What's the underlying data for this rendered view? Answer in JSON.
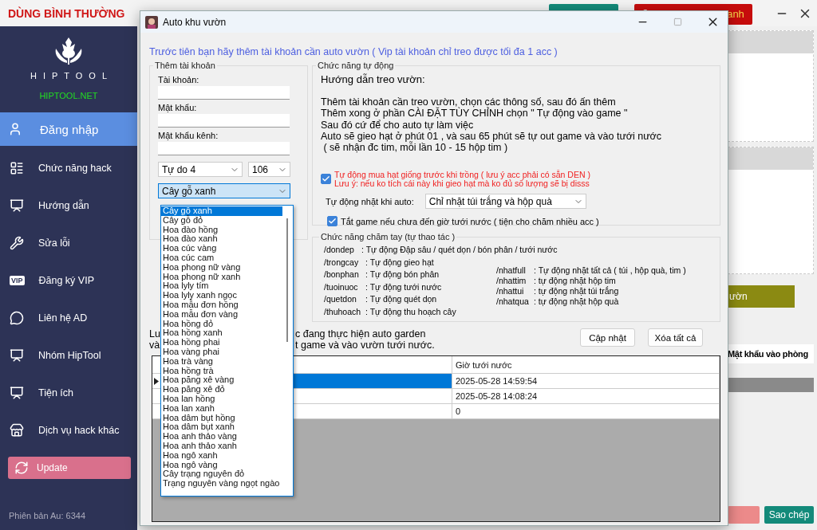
{
  "app": {
    "title": "DÙNG BÌNH THƯỜNG",
    "top_buttons": [
      {
        "kind": "teal"
      },
      {
        "kind": "danger",
        "label": "anh"
      }
    ]
  },
  "sidebar": {
    "brand": "HIPTOOL",
    "site": "HIPTOOL.NET",
    "items": [
      {
        "label": "Đăng nhập",
        "selected": true
      },
      {
        "label": "Chức năng hack",
        "selected": false
      },
      {
        "label": "Hướng dẫn",
        "selected": false
      },
      {
        "label": "Sửa lỗi",
        "selected": false
      },
      {
        "label": "Đăng ký  VIP",
        "badge": "VIP",
        "selected": false
      },
      {
        "label": "Liên hệ AD",
        "selected": false
      },
      {
        "label": "Nhóm HipTool",
        "selected": false
      },
      {
        "label": "Tiện ích",
        "selected": false
      },
      {
        "label": "Dịch vụ hack khác",
        "selected": false
      }
    ],
    "update_button": "Update",
    "version": "Phiên bản Au: 6344"
  },
  "background_panel": {
    "buttons": [
      {
        "kind": "olive",
        "label": "ườn"
      }
    ],
    "column_header": "Mật khẩu vào phòng",
    "bottom_buttons": [
      {
        "kind": "pink"
      },
      {
        "kind": "teal",
        "label": "Sao chép"
      }
    ]
  },
  "dialog": {
    "title": "Auto khu vườn",
    "instruction": "Trước tiên bạn hãy thêm tài khoản cần auto vườn ( Vip tài khoản chỉ treo được tối đa 1 acc )",
    "add_account": {
      "title": "Thêm tài khoản",
      "fields": [
        {
          "label": "Tài khoản:"
        },
        {
          "label": "Mật khẩu:"
        },
        {
          "label": "Mật khẩu kênh:"
        }
      ],
      "server_select": "Tự do 4",
      "number_select": "106",
      "plant_select": "Cây gỗ xanh",
      "plant_options": [
        {
          "label": "Cây gỗ xanh",
          "selected": true
        },
        {
          "label": "Cây gỗ đỏ",
          "selected": false
        },
        {
          "label": "Hoa đào hồng",
          "selected": false
        },
        {
          "label": "Hoa đào xanh",
          "selected": false
        },
        {
          "label": "Hoa cúc vàng",
          "selected": false
        },
        {
          "label": "Hoa cúc cam",
          "selected": false
        },
        {
          "label": "Hoa phong nữ vàng",
          "selected": false
        },
        {
          "label": "Hoa phong nữ xanh",
          "selected": false
        },
        {
          "label": "Hoa lyly tím",
          "selected": false
        },
        {
          "label": "Hoa lyly xanh ngọc",
          "selected": false
        },
        {
          "label": "Hoa mẫu đơn hồng",
          "selected": false
        },
        {
          "label": "Hoa mẫu đơn vàng",
          "selected": false
        },
        {
          "label": "Hoa hồng đỏ",
          "selected": false
        },
        {
          "label": "Hoa hồng xanh",
          "selected": false
        },
        {
          "label": "Hoa hồng phai",
          "selected": false
        },
        {
          "label": "Hoa vàng phai",
          "selected": false
        },
        {
          "label": "Hoa trà vàng",
          "selected": false
        },
        {
          "label": "Hoa hồng trà",
          "selected": false
        },
        {
          "label": "Hoa păng xê vàng",
          "selected": false
        },
        {
          "label": "Hoa păng xê đỏ",
          "selected": false
        },
        {
          "label": "Hoa lan hồng",
          "selected": false
        },
        {
          "label": "Hoa lan xanh",
          "selected": false
        },
        {
          "label": "Hoa dâm bụt hồng",
          "selected": false
        },
        {
          "label": "Hoa dâm bụt xanh",
          "selected": false
        },
        {
          "label": "Hoa anh thảo vàng",
          "selected": false
        },
        {
          "label": "Hoa anh thảo xanh",
          "selected": false
        },
        {
          "label": "Hoa ngô xanh",
          "selected": false
        },
        {
          "label": "Hoa ngô vàng",
          "selected": false
        },
        {
          "label": "Cây trạng nguyên đỏ",
          "selected": false
        },
        {
          "label": "Trạng nguyên vàng ngọt ngào",
          "selected": false
        }
      ]
    },
    "auto": {
      "title": "Chức năng tự động",
      "heading": "Hướng dẫn treo vườn:",
      "guide": [
        "Thêm tài khoản cần treo vườn, chọn các thông số, sau đó ấn thêm",
        "Thêm xong ở phần CÀI ĐẶT TÙY CHỈNH chọn \" Tự động vào game \"",
        "Sau đó cứ để cho auto tự làm việc",
        "Auto sẽ gieo hạt ở phút 01 , và sau 65 phút sẽ tự out game và vào tưới nước",
        " ( sẽ nhận đc tim, mỗi lần 10 - 15 hộp tim )"
      ],
      "buy_seeds": {
        "checked": true,
        "lines": [
          "Tự động mua hạt giống trước khi trồng ( lưu ý acc phải có sẵn DEN )",
          "Lưu ý: nếu ko tích cái này khi gieo hạt mà ko đủ số lượng sẽ bị disss"
        ]
      },
      "pickup_label": "Tự động nhặt khi auto:",
      "pickup_select": "Chỉ nhặt túi trắng và hộp quà",
      "close_game": {
        "checked": true,
        "label": "Tắt game nếu chưa đến giờ tưới nước ( tiện cho chăm nhiều acc )"
      }
    },
    "manual": {
      "title": "Chức năng chăm tay (tự thao tác )",
      "left": [
        {
          "command": "/dondep",
          "description": ": Tự động Đập sâu /  quét dọn / bón phân / tưới nước"
        },
        {
          "command": "/trongcay",
          "description": ": Tự động gieo hạt"
        },
        {
          "command": "/bonphan",
          "description": ": Tự động bón phân"
        },
        {
          "command": "/tuoinuoc",
          "description": ": Tự động tưới nước"
        },
        {
          "command": "/quetdon",
          "description": ": Tự động quét dọn"
        },
        {
          "command": "/thuhoach",
          "description": ": Tự động thu hoạch cây"
        }
      ],
      "right": [
        {
          "command": "/nhatfull",
          "description": ": Tự động nhặt tất cả ( túi , hộp quà, tim )"
        },
        {
          "command": "/nhattim",
          "description": ": tự động nhặt hộp tim"
        },
        {
          "command": "/nhattui",
          "description": ": tự động nhặt túi trắng"
        },
        {
          "command": "/nhatqua",
          "description": ": tự động nhặt hộp quà"
        }
      ]
    },
    "note": {
      "left": [
        "Lu",
        "và"
      ],
      "right": [
        "c đang thực hiện auto garden",
        "t game và vào vườn tưới nước."
      ]
    },
    "buttons": [
      "Cập nhật",
      "Xóa tất cả"
    ],
    "table": {
      "column_2": "Giờ tưới nước",
      "rows": [
        {
          "selected": true,
          "current": true,
          "watering_time": "2025-05-28 14:59:54"
        },
        {
          "selected": false,
          "current": false,
          "watering_time": "2025-05-28 14:08:24"
        },
        {
          "selected": false,
          "current": false,
          "watering_time": "0"
        }
      ]
    }
  }
}
